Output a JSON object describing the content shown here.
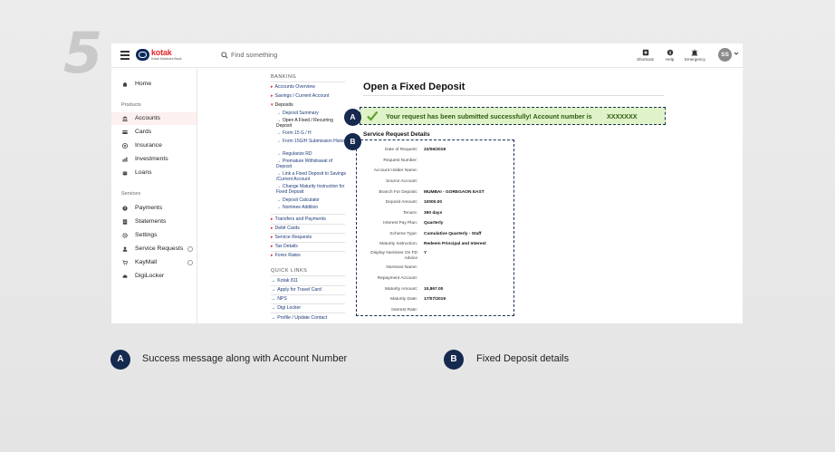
{
  "step_number": "5",
  "topbar": {
    "logo_name": "kotak",
    "logo_sub": "Kotak Mahindra Bank",
    "search_placeholder": "Find something",
    "shortcuts_label": "Shortcuts",
    "help_label": "Help",
    "emergency_label": "Emergency",
    "avatar_initials": "SS"
  },
  "sidebar": {
    "home": "Home",
    "products_heading": "Products",
    "products": [
      "Accounts",
      "Cards",
      "Insurance",
      "Investments",
      "Loans"
    ],
    "services_heading": "Services",
    "services": [
      "Payments",
      "Statements",
      "Settings",
      "Service Requests",
      "KayMall",
      "DigiLocker"
    ]
  },
  "banking": {
    "heading": "BANKING",
    "top_links": [
      "Accounts Overview",
      "Savings / Current Account"
    ],
    "deposits_label": "Deposits",
    "deposit_subs": [
      "Deposit Summary",
      "Open A Fixed / Recurring Deposit",
      "Form 15 G / H",
      "Form 15G/H Submission History",
      "Regularize RD",
      "Premature Withdrawal of Deposit",
      "Link a Fixed Deposit to Savings /Current Account",
      "Change Maturity Instruction for Fixed Deposit",
      "Deposit Calculator",
      "Nominee Addition"
    ],
    "more_links": [
      "Transfers and Payments",
      "Debit Cards",
      "Service Requests",
      "Tax Details",
      "Forex Rates"
    ],
    "quick_links_heading": "QUICK LINKS",
    "quick_links": [
      "Kotak 811",
      "Apply for Travel Card",
      "NPS",
      "Digi Locker",
      "Profile / Update Contact"
    ]
  },
  "main": {
    "title": "Open a Fixed Deposit",
    "success_message": "Your request has been submitted successfully! Account number is",
    "account_number": "XXXXXXX",
    "section_title": "Service Request Details",
    "details": [
      {
        "label": "Date of Request:",
        "value": "22/06/2018"
      },
      {
        "label": "Request Number:",
        "value": ""
      },
      {
        "label": "Account Holder Name:",
        "value": ""
      },
      {
        "label": "Source Account:",
        "value": ""
      },
      {
        "label": "Branch For Deposit:",
        "value": "MUMBAI - GOREGAON EAST"
      },
      {
        "label": "Deposit Amount:",
        "value": "10000.00"
      },
      {
        "label": "Tenure:",
        "value": "390 days"
      },
      {
        "label": "Interest Pay Plan:",
        "value": "Quarterly"
      },
      {
        "label": "Scheme Type:",
        "value": "Cumulative Quarterly - Staff"
      },
      {
        "label": "Maturity Instruction:",
        "value": "Redeem Principal and Interest"
      },
      {
        "label": "Display Nominee On FD Advice",
        "value": "Y"
      },
      {
        "label": "Nominee Name:",
        "value": ""
      },
      {
        "label": "Repayment Account:",
        "value": ""
      },
      {
        "label": "Maturity Amount:",
        "value": "10,867.00"
      },
      {
        "label": "Maturity Date:",
        "value": "17/07/2019"
      },
      {
        "label": "Interest Rate:",
        "value": ""
      }
    ]
  },
  "callouts": {
    "a": "A",
    "b": "B"
  },
  "legend": {
    "a_text": "Success message along with Account Number",
    "b_text": "Fixed Deposit details"
  },
  "colors": {
    "brand_red": "#e0232b",
    "navy": "#16294f",
    "success_bg": "#dff2c8",
    "success_text": "#2e5c12"
  }
}
